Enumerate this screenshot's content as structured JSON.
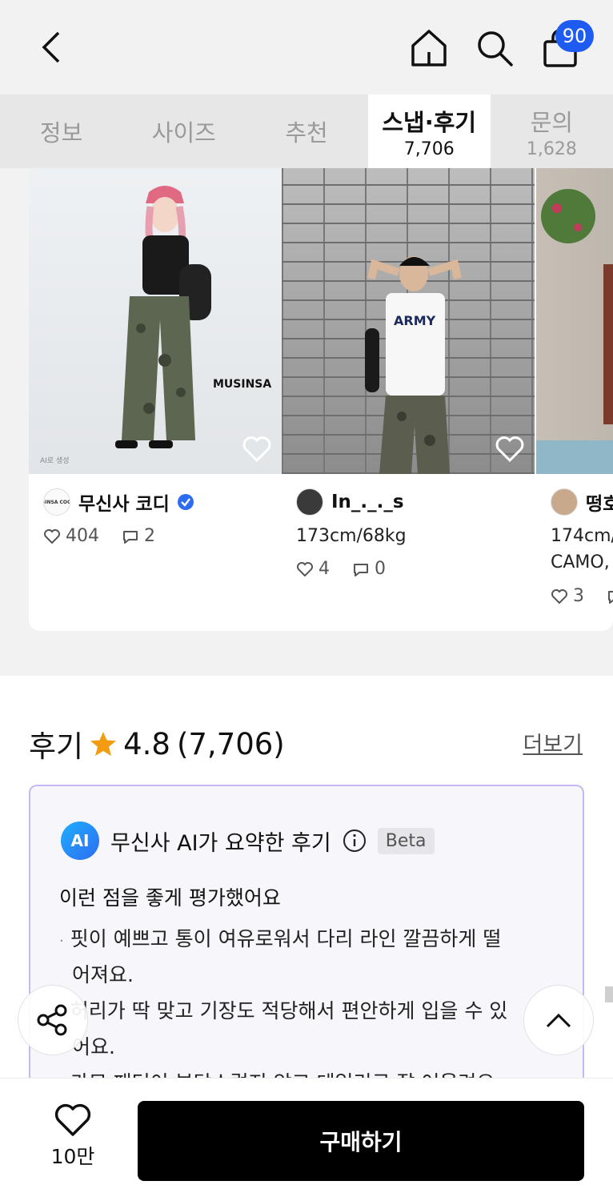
{
  "header": {
    "cart_badge": "90"
  },
  "tabs": [
    {
      "label": "정보",
      "count": ""
    },
    {
      "label": "사이즈",
      "count": ""
    },
    {
      "label": "추천",
      "count": ""
    },
    {
      "label": "스냅·후기",
      "count": "7,706"
    },
    {
      "label": "문의",
      "count": "1,628"
    }
  ],
  "snaps": [
    {
      "image_text": "MUSINSA",
      "image_caption": "AI로 생성",
      "avatar_text": "MUSINSA COORDI",
      "user": "무신사 코디",
      "likes": "404",
      "comments": "2"
    },
    {
      "user": "In_._._s",
      "body_info": "173cm/68kg",
      "likes": "4",
      "comments": "0"
    },
    {
      "user": "떵호",
      "body_info": "174cm/",
      "extra": "CAMO,",
      "likes": "3"
    }
  ],
  "review": {
    "title": "후기",
    "rating": "4.8",
    "count": "(7,706)",
    "more": "더보기"
  },
  "ai_summary": {
    "logo": "AI",
    "title": "무신사 AI가 요약한 후기",
    "badge": "Beta",
    "subtitle": "이런 점을 좋게 평가했어요",
    "lines": [
      "핏이 예쁘고 통이 여유로워서 다리 라인 깔끔하게 떨",
      "어져요.",
      "허리가 딱 맞고 기장도 적당해서 편안하게 입을 수 있",
      "어요.",
      "카모 패턴이 부담스럽지 않고 데일리로 잘 어울려요."
    ]
  },
  "bottom": {
    "like_count": "10만",
    "buy_label": "구매하기"
  },
  "colors": {
    "accent_blue": "#1e5bf0",
    "star": "#f39c12",
    "buy_bg": "#000000"
  }
}
